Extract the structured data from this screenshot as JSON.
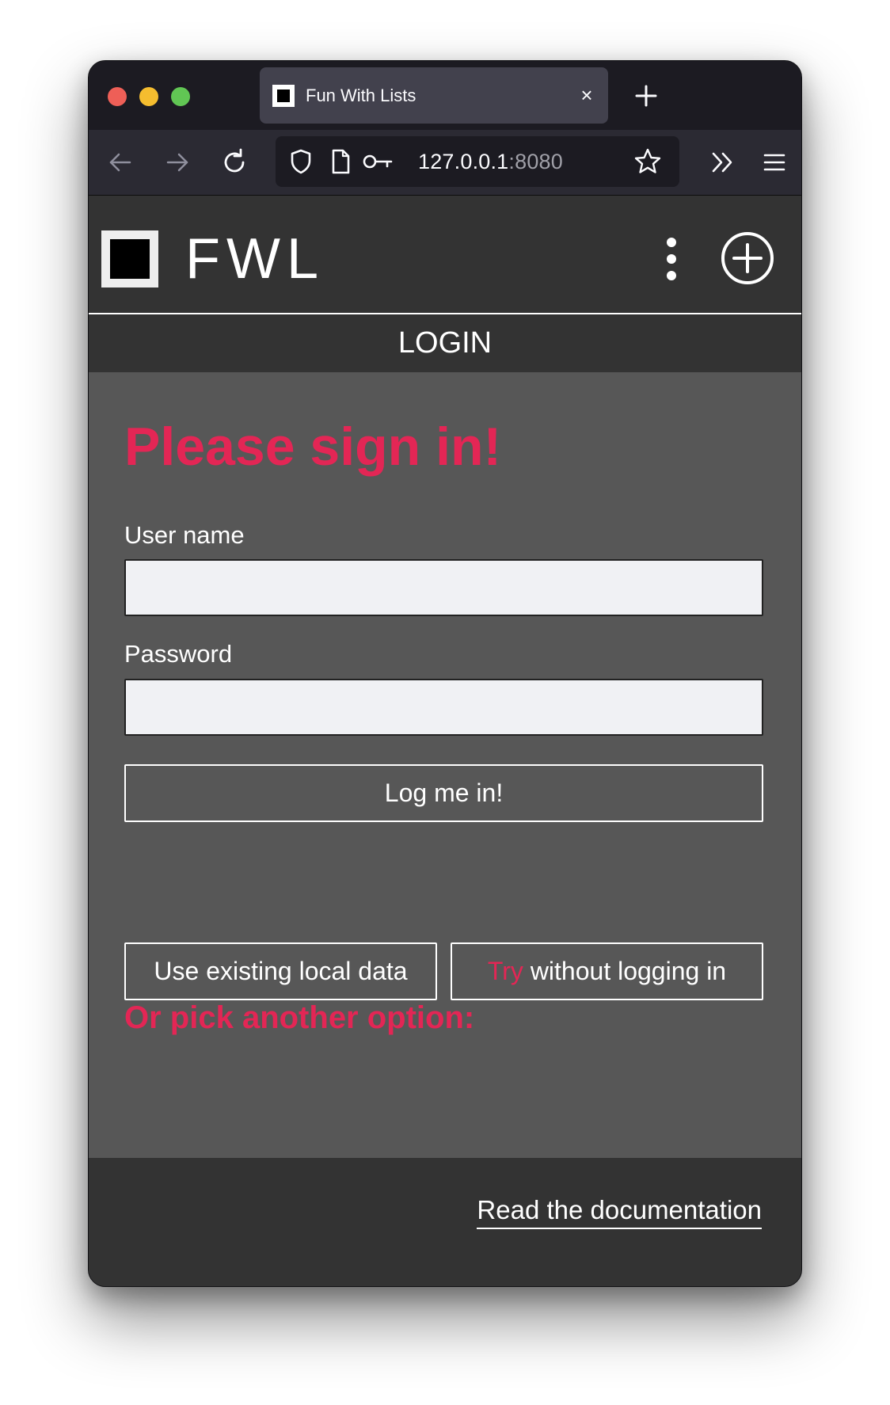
{
  "browser": {
    "tab_title": "Fun With Lists",
    "tab_close": "×",
    "url_host": "127.0.0.1",
    "url_port": ":8080"
  },
  "app": {
    "logo_text": "FWL",
    "section_title": "LOGIN"
  },
  "login": {
    "heading": "Please sign in!",
    "username_label": "User name",
    "username_value": "",
    "password_label": "Password",
    "password_value": "",
    "submit_label": "Log me in!",
    "alt_heading": "Or pick another option:",
    "local_data_label": "Use existing local data",
    "try_accent": "Try",
    "try_rest": " without logging in"
  },
  "footer": {
    "doc_link": "Read the documentation"
  },
  "colors": {
    "accent": "#e32655",
    "main_bg": "#575757",
    "header_bg": "#333333"
  }
}
